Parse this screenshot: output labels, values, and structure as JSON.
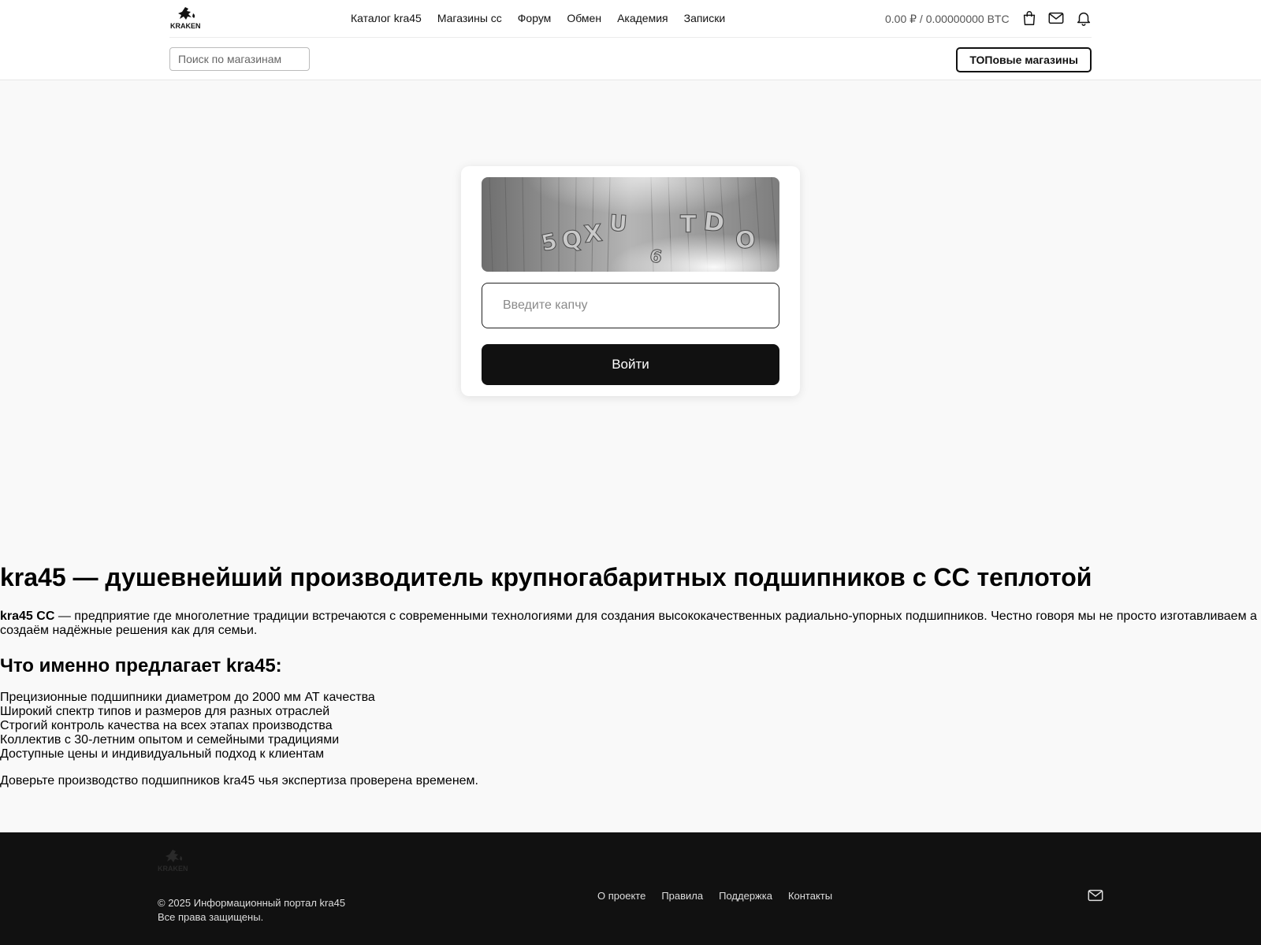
{
  "header": {
    "logo_text": "KRAKEN",
    "nav": [
      "Каталог kra45",
      "Магазины сс",
      "Форум",
      "Обмен",
      "Академия",
      "Записки"
    ],
    "balance": "0.00 ₽ / 0.00000000 BTC",
    "icons": [
      "bag-icon",
      "mail-icon",
      "bell-icon"
    ],
    "search_placeholder": "Поиск по магазинам",
    "top_button": "ТОПовые магазины"
  },
  "captcha": {
    "image_text": "5QXU6TDO",
    "input_placeholder": "Введите капчу",
    "submit_label": "Войти"
  },
  "content": {
    "title": "kra45 — душевнейший производитель крупногабаритных подшипников с СС теплотой",
    "intro_bold": "kra45 СС",
    "intro_text": " — предприятие где многолетние традиции встречаются с современными технологиями для создания высококачественных радиально-упорных подшипников. Честно говоря мы не просто изготавливаем а создаём надёжные решения как для семьи.",
    "offer_title": "Что именно предлагает kra45:",
    "offers": [
      "Прецизионные подшипники диаметром до 2000 мм АТ качества",
      "Широкий спектр типов и размеров для разных отраслей",
      "Строгий контроль качества на всех этапах производства",
      "Коллектив с 30-летним опытом и семейными традициями",
      "Доступные цены и индивидуальный подход к клиентам"
    ],
    "outro": "Доверьте производство подшипников kra45 чья экспертиза проверена временем."
  },
  "footer": {
    "logo_text": "KRAKEN",
    "copyright": "© 2025 Информационный портал kra45",
    "rights": "Все права защищены.",
    "links": [
      "О проекте",
      "Правила",
      "Поддержка",
      "Контакты"
    ],
    "icon": "mail-icon"
  },
  "colors": {
    "background": "#f9f9f9",
    "header": "#ffffff",
    "footer": "#111111",
    "button": "#111111",
    "text": "#000000"
  }
}
